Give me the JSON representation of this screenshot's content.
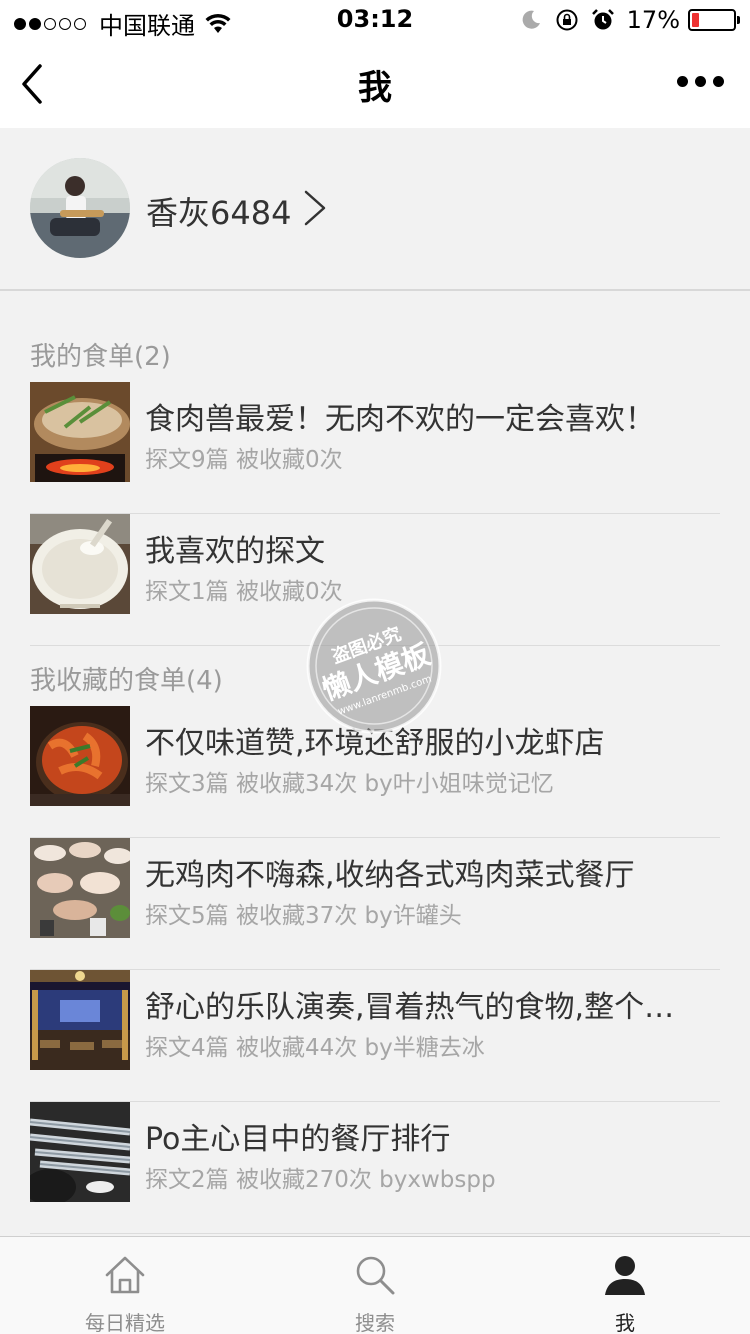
{
  "status_bar": {
    "carrier": "中国联通",
    "time": "03:12",
    "battery": "17%",
    "battery_level": 0.17,
    "signal_bars": 2
  },
  "nav": {
    "title": "我",
    "back_icon": "chevron-left-icon",
    "more_icon": "more-icon"
  },
  "profile": {
    "username": "香灰6484"
  },
  "my_lists": {
    "title": "我的食单(2)",
    "items": [
      {
        "title": "食肉兽最爱！无肉不欢的一定会喜欢！",
        "meta": "探文9篇 被收藏0次"
      },
      {
        "title": "我喜欢的探文",
        "meta": "探文1篇 被收藏0次"
      }
    ]
  },
  "fav_lists": {
    "title": "我收藏的食单(4)",
    "items": [
      {
        "title": "不仅味道赞,环境还舒服的小龙虾店",
        "meta": "探文3篇 被收藏34次 by叶小姐味觉记忆"
      },
      {
        "title": "无鸡肉不嗨森,收纳各式鸡肉菜式餐厅",
        "meta": "探文5篇 被收藏37次 by许罐头"
      },
      {
        "title": "舒心的乐队演奏,冒着热气的食物,整个…",
        "meta": "探文4篇 被收藏44次 by半糖去冰"
      },
      {
        "title": "Po主心目中的餐厅排行",
        "meta": "探文2篇 被收藏270次 byxwbspp"
      }
    ]
  },
  "watermark": {
    "line1": "盗图必究",
    "line2": "懒人模板",
    "line3": "www.lanrenmb.com"
  },
  "tabbar": {
    "tabs": [
      {
        "label": "每日精选",
        "icon": "home-icon"
      },
      {
        "label": "搜索",
        "icon": "search-icon"
      },
      {
        "label": "我",
        "icon": "user-icon"
      }
    ],
    "active": 2
  },
  "colors": {
    "background": "#f2f2f2",
    "text": "#333333",
    "meta": "#a6a6a6",
    "battery_low": "#ee3333"
  }
}
